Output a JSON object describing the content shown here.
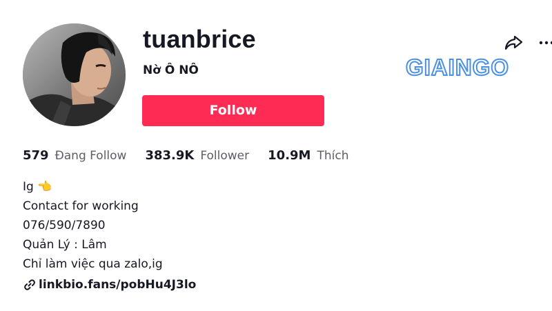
{
  "profile": {
    "username": "tuanbrice",
    "nickname": "Nờ Ô NÔ",
    "follow_label": "Follow"
  },
  "watermark": {
    "text": "GIAINGO",
    "color": "#4a90e2"
  },
  "stats": [
    {
      "value": "579",
      "label": "Đang Follow"
    },
    {
      "value": "383.9K",
      "label": "Follower"
    },
    {
      "value": "10.9M",
      "label": "Thích"
    }
  ],
  "bio": {
    "lines": [
      "Ig 👈",
      "Contact for working",
      "076/590/7890",
      "Quản Lý : Lâm",
      "Chỉ làm việc qua zalo,ig"
    ]
  },
  "link": {
    "text": "linkbio.fans/pobHu4J3lo"
  },
  "colors": {
    "accent": "#fe2c55",
    "text": "#161823",
    "secondary": "#5c5e66"
  },
  "icons": {
    "share": "share-icon",
    "more": "more-icon",
    "link": "link-icon"
  }
}
